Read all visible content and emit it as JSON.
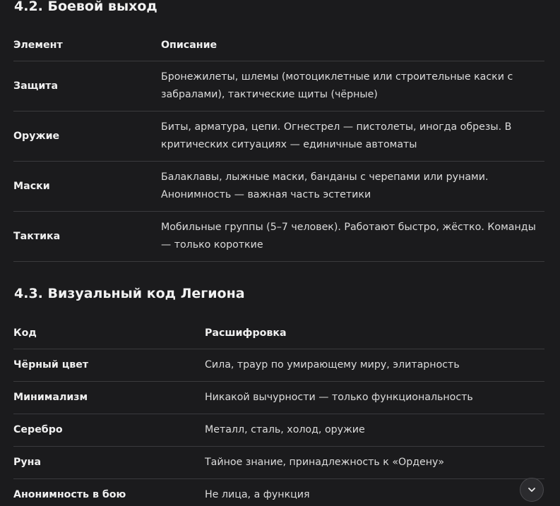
{
  "sections": [
    {
      "title": "4.2. Боевой выход",
      "columns": [
        "Элемент",
        "Описание"
      ],
      "rows": [
        [
          "Защита",
          "Бронежилеты, шлемы (мотоциклетные или строительные каски с забралами), тактические щиты (чёрные)"
        ],
        [
          "Оружие",
          "Биты, арматура, цепи. Огнестрел — пистолеты, иногда обрезы. В критических ситуациях — единичные автоматы"
        ],
        [
          "Маски",
          "Балаклавы, лыжные маски, банданы с черепами или рунами. Анонимность — важная часть эстетики"
        ],
        [
          "Тактика",
          "Мобильные группы (5–7 человек). Работают быстро, жёстко. Команды — только короткие"
        ]
      ]
    },
    {
      "title": "4.3. Визуальный код Легиона",
      "columns": [
        "Код",
        "Расшифровка"
      ],
      "rows": [
        [
          "Чёрный цвет",
          "Сила, траур по умирающему миру, элитарность"
        ],
        [
          "Минимализм",
          "Никакой вычурности — только функциональность"
        ],
        [
          "Серебро",
          "Металл, сталь, холод, оружие"
        ],
        [
          "Руна",
          "Тайное знание, принадлежность к «Ордену»"
        ],
        [
          "Анонимность в бою",
          "Не лица, а функция"
        ]
      ]
    }
  ],
  "scroll_button": {
    "icon": "chevron-down-icon"
  },
  "colors": {
    "background": "#1b1b1d",
    "text": "#e8e8e8",
    "divider": "#3a3a3d",
    "button_bg": "#2b2b2e"
  }
}
